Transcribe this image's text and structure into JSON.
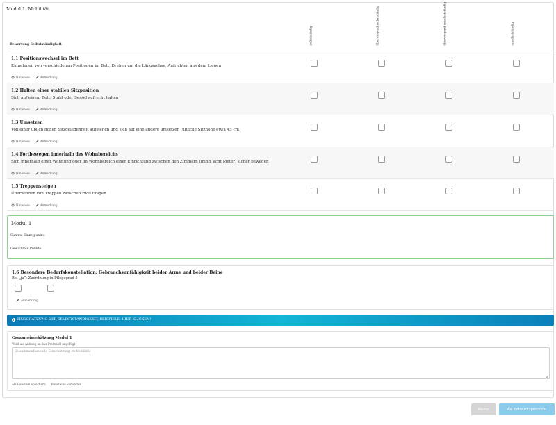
{
  "module_title": "Modul 1: Mobilität",
  "table": {
    "row_header_label": "Bewertung Selbstständigkeit",
    "columns": [
      "selbstständig",
      "überwiegend selbstständig",
      "überwiegend unselbstständig",
      "unselbstständig"
    ]
  },
  "criteria": [
    {
      "title": "1.1 Positionswechsel im Bett",
      "description": "Einnehmen von verschiedenen Positionen im Bett, Drehen um die Längsachse, Aufrichten aus dem Liegen",
      "hint_label": "Hinweise",
      "note_label": "Anmerkung"
    },
    {
      "title": "1.2 Halten einer stabilen Sitzposition",
      "description": "Sich auf einem Bett, Stuhl oder Sessel aufrecht halten",
      "hint_label": "Hinweise",
      "note_label": "Anmerkung"
    },
    {
      "title": "1.3 Umsetzen",
      "description": "Von einer üblich hohen Sitzgelegenheit aufstehen und sich auf eine andere umsetzen (übliche Sitzhöhe etwa 45 cm)",
      "hint_label": "Hinweise",
      "note_label": "Anmerkung"
    },
    {
      "title": "1.4 Fortbewegen innerhalb des Wohnbereichs",
      "description": "Sich innerhalb einer Wohnung oder im Wohnbereich einer Einrichtung zwischen den Zimmern (mind. acht Meter) sicher bewegen",
      "hint_label": "Hinweise",
      "note_label": "Anmerkung"
    },
    {
      "title": "1.5 Treppensteigen",
      "description": "Überwinden von Treppen zwischen zwei Etagen",
      "hint_label": "Hinweise",
      "note_label": "Anmerkung"
    }
  ],
  "modul_summary": {
    "title": "Modul 1",
    "sum_label": "Summe Einzelpunkte",
    "weighted_label": "Gewichtete Punkte"
  },
  "special": {
    "title": "1.6 Besondere Bedarfskonstellation: Gebrauchsunfähigkeit beider Arme und beider Beine",
    "text": "Bei „ja“: Zuordnung in Pflegegrad 5",
    "note_label": "Anmerkung"
  },
  "info_banner": {
    "text": "EINSCHÄTZUNG DER SELBSTSTÄNDIGKEIT, BEISPIELE: HIER KLICKEN!"
  },
  "summary": {
    "title": "Gesamteinschätzung Modul 1",
    "hint": "Wird als Anhang an das Protokoll angefügt",
    "placeholder": "Zusammenfassende Einschätzung zu Mobilität",
    "save_as_block": "Als Baustein speichern",
    "manage_blocks": "Bausteine verwalten"
  },
  "buttons": {
    "next": "Weiter",
    "save_draft": "Als Entwurf speichern"
  },
  "colors": {
    "banner_start": "#0b79b5",
    "banner_mid": "#12b6d6",
    "save_button": "#8ccbe9",
    "next_button_disabled": "#d5d5d5",
    "module_box_border": "#8fd18f"
  }
}
